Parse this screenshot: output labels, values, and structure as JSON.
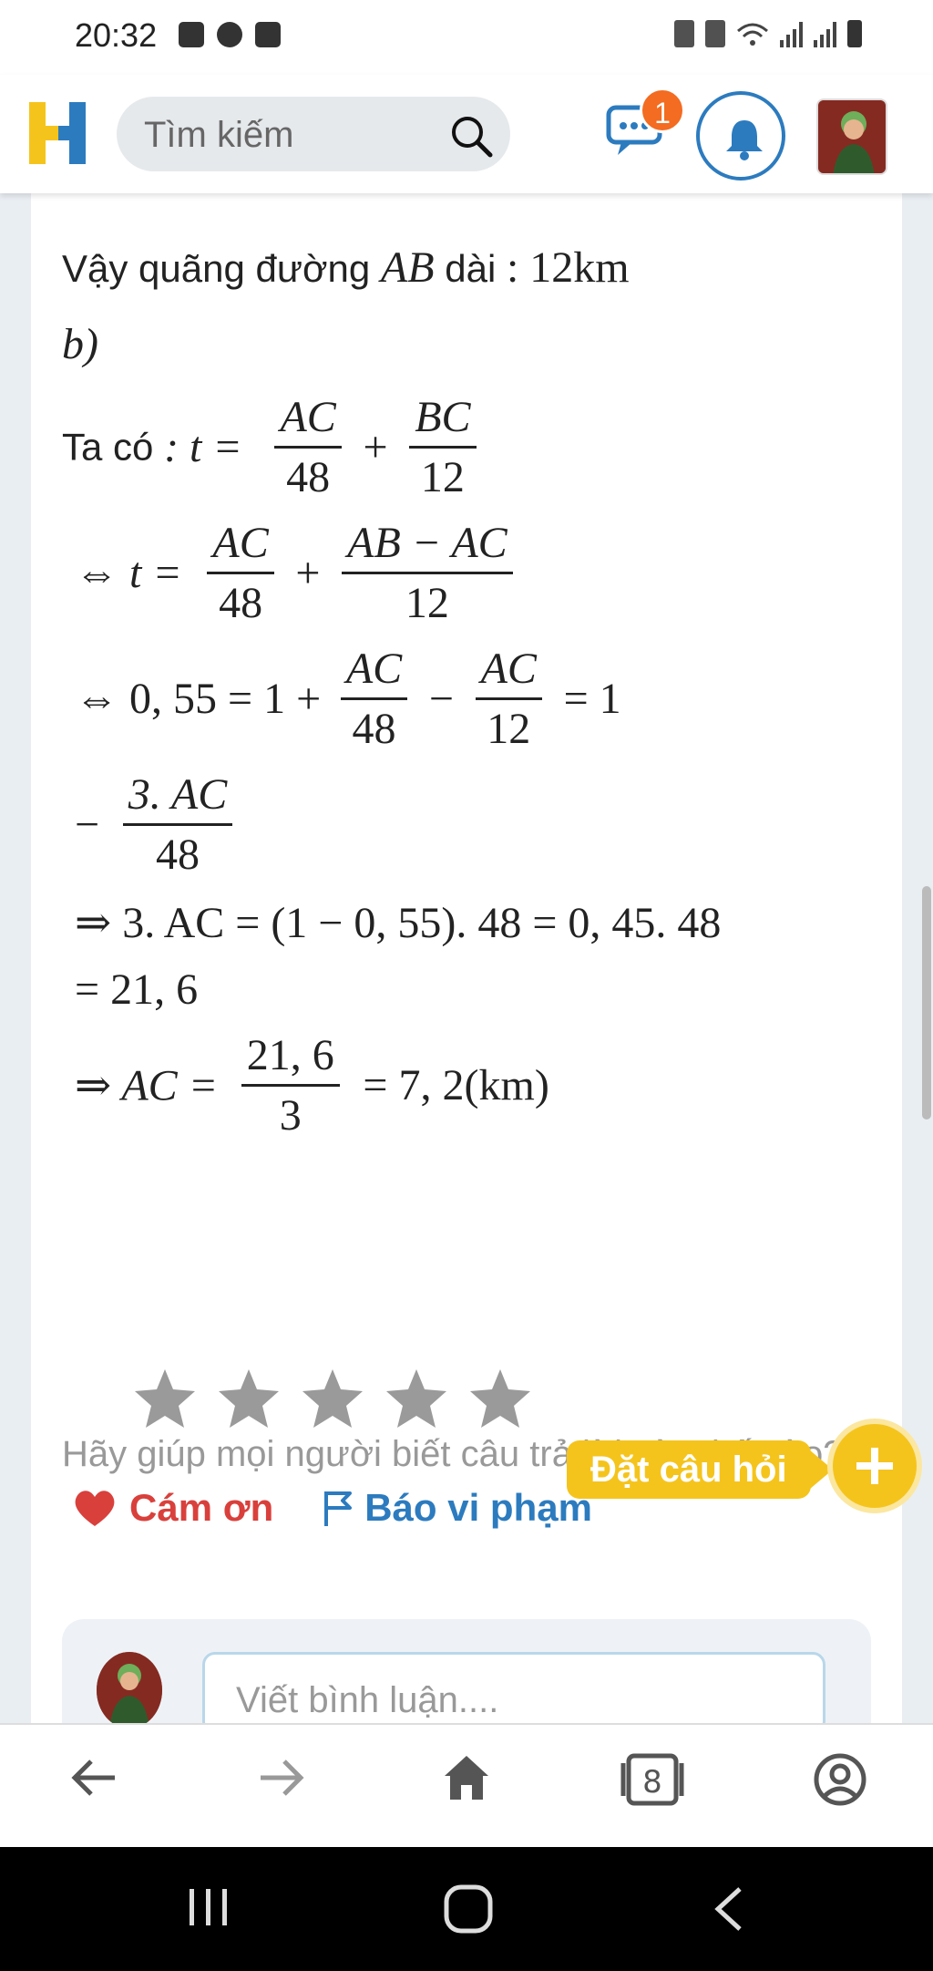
{
  "status_bar": {
    "time": "20:32"
  },
  "header": {
    "search_placeholder": "Tìm kiếm",
    "chat_badge_count": "1"
  },
  "answer": {
    "conclusion_text": "Vậy quãng đường",
    "conclusion_ab": "AB",
    "conclusion_dai": "dài",
    "conclusion_value": ": 12km",
    "part_b": "b)",
    "taco": "Ta có",
    "lines": {
      "l1_lhs": ": t =",
      "l1_f1_num": "AC",
      "l1_f1_den": "48",
      "l1_plus": "+",
      "l1_f2_num": "BC",
      "l1_f2_den": "12",
      "l2_lhs": "⇔ t =",
      "l2_f1_num": "AC",
      "l2_f1_den": "48",
      "l2_plus": "+",
      "l2_f2_num": "AB − AC",
      "l2_f2_den": "12",
      "l3_lhs": "⇔ 0, 55 = 1 +",
      "l3_f1_num": "AC",
      "l3_f1_den": "48",
      "l3_minus": "−",
      "l3_f2_num": "AC",
      "l3_f2_den": "12",
      "l3_rhs": "= 1",
      "l4_minus": "−",
      "l4_f_num": "3. AC",
      "l4_f_den": "48",
      "l5": "⇒ 3. AC = (1 − 0, 55). 48 = 0, 45. 48",
      "l6": "= 21, 6",
      "l7_lhs": "⇒ AC =",
      "l7_f_num": "21, 6",
      "l7_f_den": "3",
      "l7_rhs": "= 7, 2(km)"
    }
  },
  "feedback": {
    "prompt": "Hãy giúp mọi người biết câu trả lời này thế nào?",
    "stars": 5
  },
  "actions": {
    "thanks_label": "Cám ơn",
    "report_label": "Báo vi phạm"
  },
  "ask_button": {
    "label": "Đặt câu hỏi"
  },
  "comment": {
    "placeholder": "Viết bình luận...."
  },
  "colors": {
    "brand_yellow": "#f5c41c",
    "brand_blue": "#2c7bbf",
    "thanks_red": "#d9403c",
    "badge_orange": "#f36c21"
  }
}
